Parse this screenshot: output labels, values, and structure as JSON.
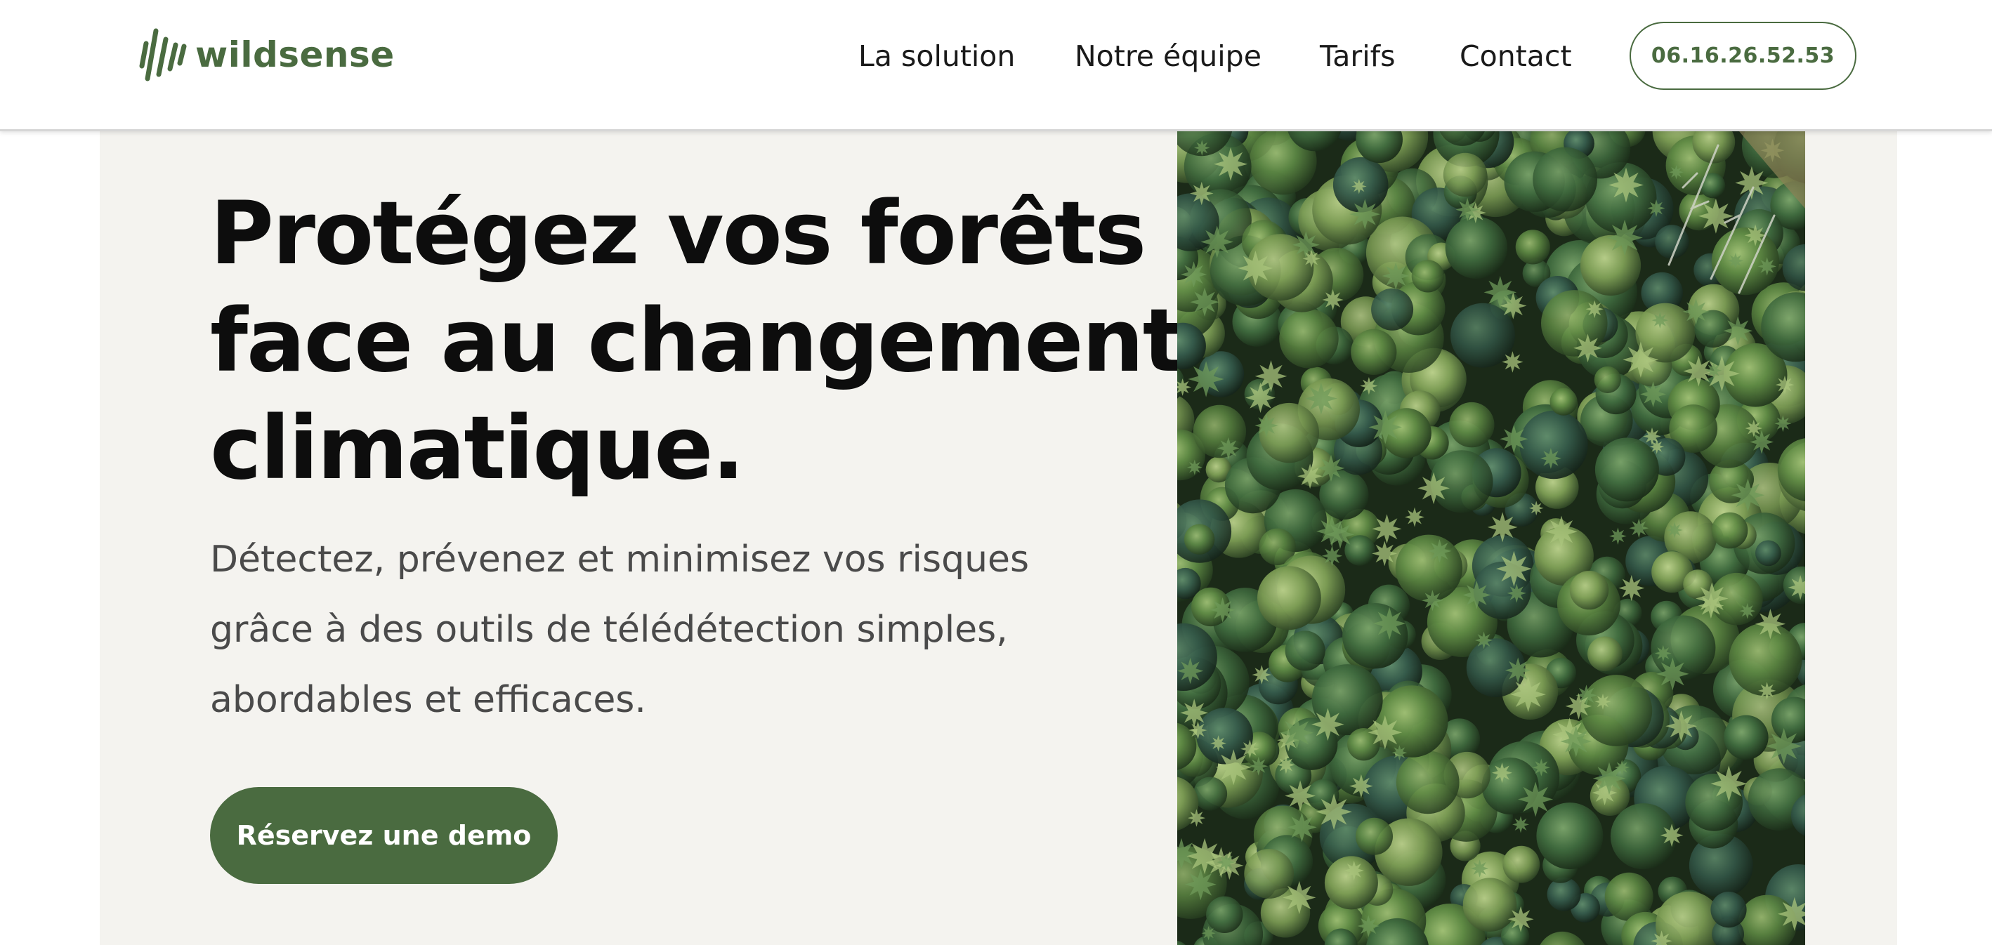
{
  "header": {
    "logo": {
      "text": "wildsense",
      "icon": "wildsense-logo-icon"
    },
    "nav": [
      {
        "label": "La solution"
      },
      {
        "label": "Notre équipe"
      },
      {
        "label": "Tarifs"
      },
      {
        "label": "Contact"
      }
    ],
    "phone_button": "06.16.26.52.53"
  },
  "hero": {
    "title_lines": [
      "Protégez vos forêts",
      "face au changement",
      "climatique."
    ],
    "subtitle_lines": [
      "Détectez, prévenez et minimisez vos risques",
      "grâce à des outils de télédétection simples,",
      "abordables et efficaces."
    ],
    "cta": "Réservez une demo",
    "image": "aerial-forest-photo"
  },
  "colors": {
    "brand_green": "#4a6b40",
    "hero_background": "#f4f3ef",
    "title_text": "#0d0d0d",
    "subtitle_text": "#4a4a4a"
  }
}
